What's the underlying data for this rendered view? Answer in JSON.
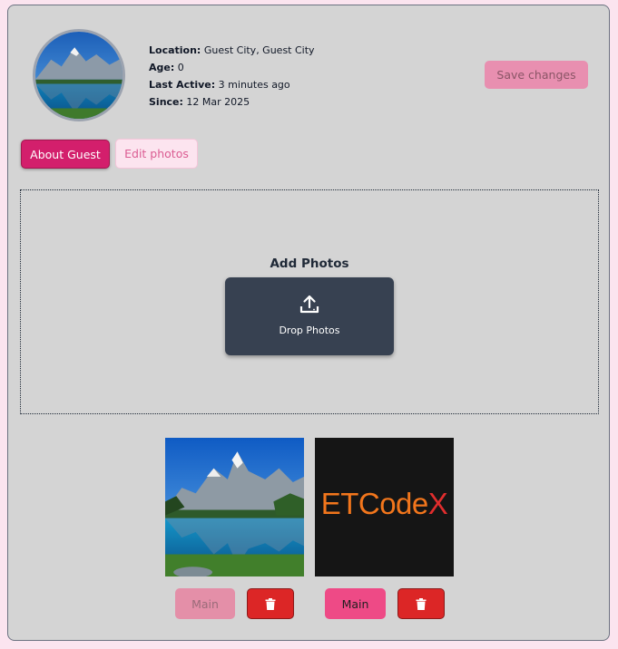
{
  "profile": {
    "location_label": "Location:",
    "location_value": "Guest City, Guest City",
    "age_label": "Age:",
    "age_value": "0",
    "last_active_label": "Last Active:",
    "last_active_value": "3 minutes ago",
    "since_label": "Since:",
    "since_value": "12 Mar 2025"
  },
  "actions": {
    "save_label": "Save changes"
  },
  "tabs": [
    {
      "label": "About Guest",
      "active": true
    },
    {
      "label": "Edit photos",
      "active": false
    }
  ],
  "upload": {
    "title": "Add Photos",
    "drop_label": "Drop Photos",
    "icon": "upload-icon"
  },
  "photos": [
    {
      "image": "mountain-lake-photo",
      "main_label": "Main",
      "is_main": true,
      "delete_icon": "trash-icon"
    },
    {
      "image": "etcodex-logo",
      "logo_text_part1": "ETCode",
      "logo_text_part2": "X",
      "main_label": "Main",
      "is_main": false,
      "delete_icon": "trash-icon"
    }
  ],
  "colors": {
    "accent": "#d31f6c",
    "danger": "#dc2626",
    "dropzone_button": "#374151"
  }
}
